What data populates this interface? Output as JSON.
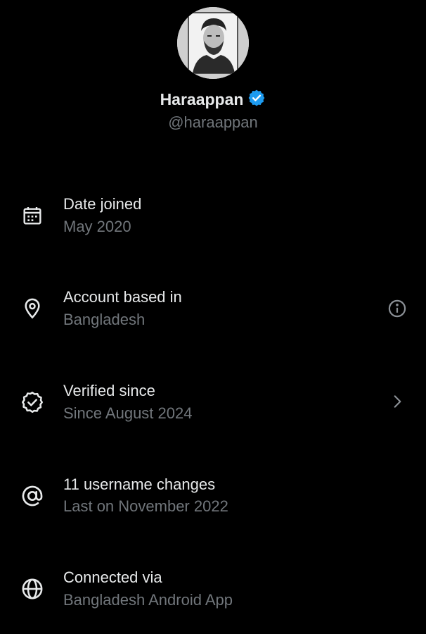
{
  "profile": {
    "name": "Haraappan",
    "handle": "@haraappan",
    "verified_color": "#1d9bf0"
  },
  "rows": [
    {
      "icon": "calendar-icon",
      "title": "Date joined",
      "subtitle": "May 2020"
    },
    {
      "icon": "location-pin-icon",
      "title": "Account based in",
      "subtitle": "Bangladesh",
      "trailing": "info-icon"
    },
    {
      "icon": "verified-badge-icon",
      "title": "Verified since",
      "subtitle": "Since August 2024",
      "trailing": "chevron-right-icon"
    },
    {
      "icon": "at-sign-icon",
      "title": "11 username changes",
      "subtitle": "Last on November 2022"
    },
    {
      "icon": "globe-icon",
      "title": "Connected via",
      "subtitle": "Bangladesh Android App"
    }
  ],
  "colors": {
    "background": "#000000",
    "primary_text": "#e7e9ea",
    "secondary_text": "#71767b"
  }
}
